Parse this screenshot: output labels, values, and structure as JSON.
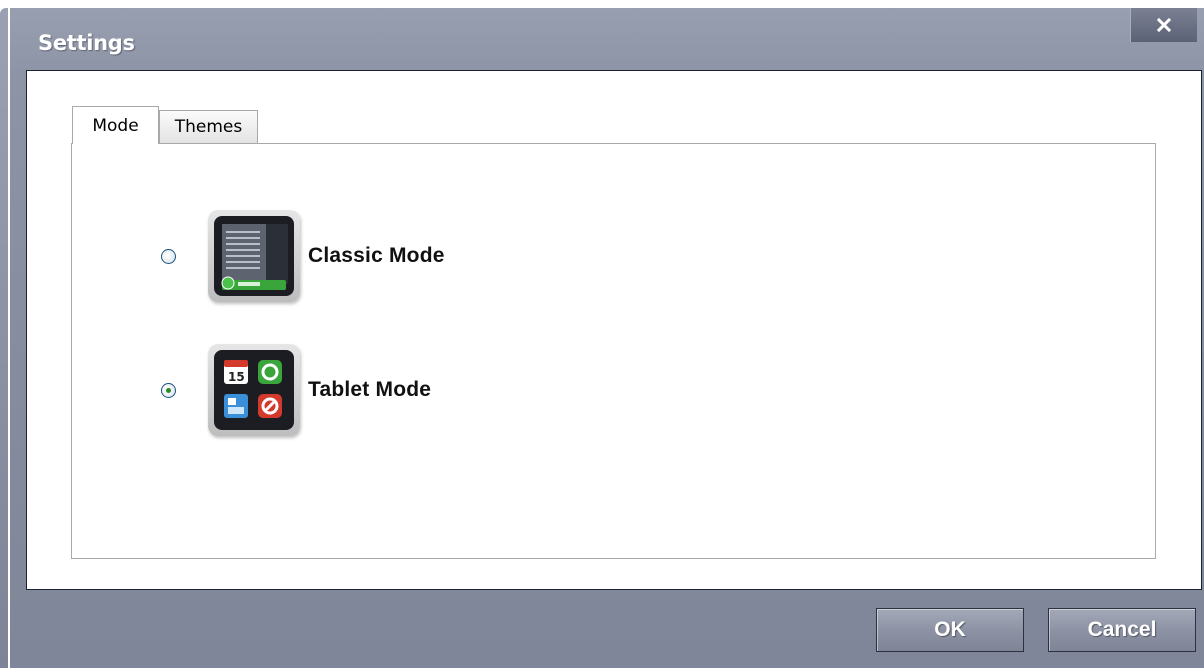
{
  "window": {
    "title": "Settings",
    "close_label": "×"
  },
  "tabs": [
    {
      "label": "Mode",
      "selected": true
    },
    {
      "label": "Themes",
      "selected": false
    }
  ],
  "options": [
    {
      "label": "Classic Mode",
      "selected": false,
      "icon": "classic-mode-icon"
    },
    {
      "label": "Tablet Mode",
      "selected": true,
      "icon": "tablet-mode-icon"
    }
  ],
  "footer": {
    "ok_label": "OK",
    "cancel_label": "Cancel"
  },
  "colors": {
    "chrome": "#868da0",
    "accent_green": "#3aa53a",
    "radio_border": "#1c5180"
  }
}
